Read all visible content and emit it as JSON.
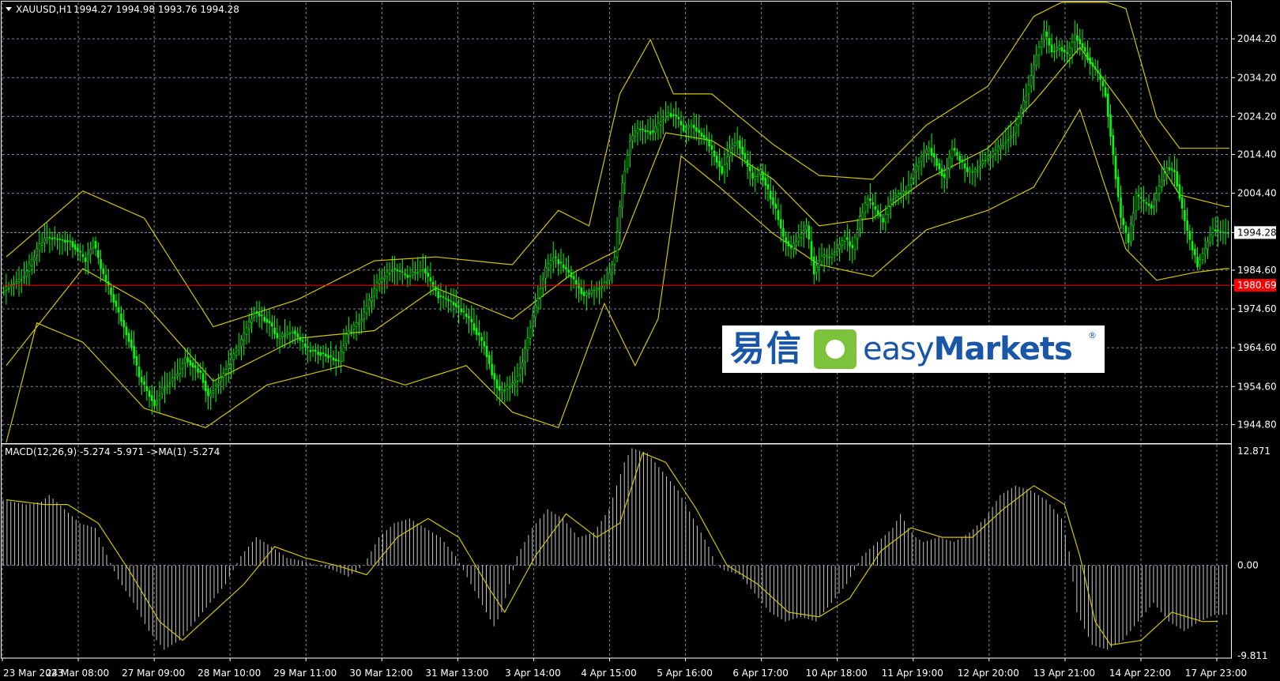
{
  "header": {
    "symbol_label": "XAUUSD,H1",
    "ohlc_label": "1994.27 1994.98 1993.76 1994.28"
  },
  "indicator": {
    "label": "MACD(12,26,9) -5.274 -5.971  ->MA(1) -5.274"
  },
  "logo": {
    "chinese": "易信",
    "english_light": "easy",
    "english_bold": "Markets",
    "registered": "®"
  },
  "colors": {
    "background": "#000000",
    "grid": "#7d8794",
    "candles": "#00ff00",
    "bands": "#d4c400",
    "current_price_line": "#8aa0b4",
    "level_line": "#ff0000",
    "macd_bars": "#c8c8c8",
    "macd_signal": "#d4c400"
  },
  "chart_data": [
    {
      "type": "candlestick",
      "symbol": "XAUUSD",
      "timeframe": "H1",
      "y_ticks": [
        "2044.20",
        "2034.20",
        "2024.20",
        "2014.40",
        "2004.40",
        "1994.28",
        "1984.60",
        "1980.69",
        "1974.60",
        "1964.60",
        "1954.60",
        "1944.80"
      ],
      "ylim": [
        1940.2,
        2053.6
      ],
      "current_price": 1994.28,
      "level_price": 1980.69,
      "x_ticks": [
        "23 Mar 2023",
        "24 Mar 08:00",
        "27 Mar 09:00",
        "28 Mar 10:00",
        "29 Mar 11:00",
        "30 Mar 12:00",
        "31 Mar 13:00",
        "3 Apr 14:00",
        "4 Apr 15:00",
        "5 Apr 16:00",
        "6 Apr 17:00",
        "10 Apr 18:00",
        "11 Apr 19:00",
        "12 Apr 20:00",
        "13 Apr 21:00",
        "14 Apr 22:00",
        "17 Apr 23:00"
      ],
      "close_path": [
        [
          0,
          1979
        ],
        [
          3,
          1983
        ],
        [
          5,
          1991
        ],
        [
          6,
          1993
        ],
        [
          9,
          1992
        ],
        [
          11,
          1987
        ],
        [
          12,
          1992
        ],
        [
          13,
          1985
        ],
        [
          15,
          1975
        ],
        [
          17,
          1965
        ],
        [
          18,
          1957
        ],
        [
          20,
          1950
        ],
        [
          21,
          1954
        ],
        [
          23,
          1958
        ],
        [
          24,
          1962
        ],
        [
          26,
          1958
        ],
        [
          27,
          1952
        ],
        [
          29,
          1958
        ],
        [
          31,
          1965
        ],
        [
          33,
          1974
        ],
        [
          35,
          1971
        ],
        [
          36,
          1967
        ],
        [
          38,
          1969
        ],
        [
          40,
          1964
        ],
        [
          42,
          1963
        ],
        [
          44,
          1961
        ],
        [
          45,
          1968
        ],
        [
          47,
          1972
        ],
        [
          49,
          1981
        ],
        [
          51,
          1985
        ],
        [
          53,
          1983
        ],
        [
          55,
          1985
        ],
        [
          57,
          1978
        ],
        [
          59,
          1976
        ],
        [
          61,
          1972
        ],
        [
          63,
          1965
        ],
        [
          64,
          1958
        ],
        [
          65,
          1953
        ],
        [
          67,
          1956
        ],
        [
          68,
          1961
        ],
        [
          69,
          1970
        ],
        [
          71,
          1985
        ],
        [
          72,
          1988
        ],
        [
          74,
          1984
        ],
        [
          76,
          1978
        ],
        [
          78,
          1980
        ],
        [
          79,
          1982
        ],
        [
          80,
          1988
        ],
        [
          81,
          2007
        ],
        [
          82,
          2018
        ],
        [
          83,
          2021
        ],
        [
          85,
          2020
        ],
        [
          86,
          2023
        ],
        [
          87,
          2025
        ],
        [
          88,
          2024
        ],
        [
          89,
          2021
        ],
        [
          90,
          2022
        ],
        [
          92,
          2018
        ],
        [
          93,
          2014
        ],
        [
          94,
          2010
        ],
        [
          95,
          2016
        ],
        [
          96,
          2018
        ],
        [
          97,
          2013
        ],
        [
          98,
          2008
        ],
        [
          99,
          2010
        ],
        [
          100,
          2005
        ],
        [
          101,
          2000
        ],
        [
          102,
          1993
        ],
        [
          103,
          1990
        ],
        [
          104,
          1993
        ],
        [
          105,
          1996
        ],
        [
          106,
          1984
        ],
        [
          107,
          1988
        ],
        [
          108,
          1988
        ],
        [
          109,
          1990
        ],
        [
          110,
          1993
        ],
        [
          111,
          1990
        ],
        [
          112,
          1998
        ],
        [
          113,
          2003
        ],
        [
          114,
          2000
        ],
        [
          115,
          1997
        ],
        [
          116,
          2003
        ],
        [
          117,
          2004
        ],
        [
          118,
          2005
        ],
        [
          119,
          2010
        ],
        [
          120,
          2014
        ],
        [
          121,
          2016
        ],
        [
          122,
          2012
        ],
        [
          123,
          2008
        ],
        [
          124,
          2016
        ],
        [
          125,
          2013
        ],
        [
          126,
          2010
        ],
        [
          127,
          2010
        ],
        [
          128,
          2013
        ],
        [
          129,
          2014
        ],
        [
          130,
          2016
        ],
        [
          131,
          2018
        ],
        [
          132,
          2020
        ],
        [
          133,
          2026
        ],
        [
          134,
          2032
        ],
        [
          135,
          2040
        ],
        [
          136,
          2046
        ],
        [
          137,
          2041
        ],
        [
          138,
          2042
        ],
        [
          139,
          2040
        ],
        [
          140,
          2045
        ],
        [
          141,
          2042
        ],
        [
          142,
          2038
        ],
        [
          143,
          2035
        ],
        [
          144,
          2030
        ],
        [
          145,
          2014
        ],
        [
          146,
          1998
        ],
        [
          147,
          1992
        ],
        [
          148,
          2004
        ],
        [
          149,
          2002
        ],
        [
          150,
          2001
        ],
        [
          151,
          2006
        ],
        [
          152,
          2011
        ],
        [
          153,
          2010
        ],
        [
          154,
          2000
        ],
        [
          155,
          1992
        ],
        [
          156,
          1986
        ],
        [
          157,
          1990
        ],
        [
          158,
          1995
        ],
        [
          159,
          1994.28
        ]
      ],
      "bands": {
        "middle": [
          [
            0,
            1960
          ],
          [
            10,
            1985
          ],
          [
            18,
            1976
          ],
          [
            27,
            1956
          ],
          [
            38,
            1967
          ],
          [
            48,
            1969
          ],
          [
            56,
            1980
          ],
          [
            66,
            1972
          ],
          [
            74,
            1984
          ],
          [
            80,
            1990
          ],
          [
            86,
            2020
          ],
          [
            92,
            2018
          ],
          [
            100,
            2008
          ],
          [
            106,
            1996
          ],
          [
            113,
            1998
          ],
          [
            120,
            2008
          ],
          [
            128,
            2016
          ],
          [
            134,
            2028
          ],
          [
            140,
            2042
          ],
          [
            146,
            2026
          ],
          [
            153,
            2004
          ],
          [
            159,
            2001
          ]
        ],
        "upper": [
          [
            0,
            1988
          ],
          [
            10,
            2005
          ],
          [
            18,
            1998
          ],
          [
            27,
            1970
          ],
          [
            38,
            1977
          ],
          [
            48,
            1987
          ],
          [
            56,
            1988
          ],
          [
            66,
            1986
          ],
          [
            72,
            2000
          ],
          [
            76,
            1996
          ],
          [
            80,
            2030
          ],
          [
            84,
            2044
          ],
          [
            87,
            2030
          ],
          [
            92,
            2030
          ],
          [
            100,
            2017
          ],
          [
            106,
            2009
          ],
          [
            113,
            2008
          ],
          [
            120,
            2022
          ],
          [
            128,
            2032
          ],
          [
            134,
            2050
          ],
          [
            140,
            2056
          ],
          [
            146,
            2052
          ],
          [
            150,
            2024
          ],
          [
            153,
            2016
          ],
          [
            159,
            2016
          ]
        ],
        "lower": [
          [
            0,
            1940
          ],
          [
            4,
            1971
          ],
          [
            10,
            1966
          ],
          [
            18,
            1949
          ],
          [
            26,
            1944
          ],
          [
            34,
            1955
          ],
          [
            44,
            1960
          ],
          [
            52,
            1955
          ],
          [
            60,
            1960
          ],
          [
            66,
            1948
          ],
          [
            72,
            1944
          ],
          [
            78,
            1976
          ],
          [
            82,
            1960
          ],
          [
            85,
            1972
          ],
          [
            88,
            2014
          ],
          [
            93,
            2006
          ],
          [
            100,
            1994
          ],
          [
            106,
            1986
          ],
          [
            113,
            1983
          ],
          [
            120,
            1995
          ],
          [
            128,
            2000
          ],
          [
            134,
            2006
          ],
          [
            140,
            2026
          ],
          [
            146,
            1990
          ],
          [
            150,
            1982
          ],
          [
            155,
            1984
          ],
          [
            159,
            1985
          ]
        ]
      }
    },
    {
      "type": "bar",
      "name": "MACD(12,26,9)",
      "y_ticks": [
        "12.871",
        "0.00",
        "-9.811"
      ],
      "ylim": [
        -9.811,
        12.871
      ],
      "macd_path": [
        [
          0,
          7
        ],
        [
          3,
          6.5
        ],
        [
          5,
          6.8
        ],
        [
          6,
          7.5
        ],
        [
          8,
          6
        ],
        [
          10,
          4.5
        ],
        [
          12,
          4
        ],
        [
          13,
          2
        ],
        [
          15,
          -1.5
        ],
        [
          17,
          -4
        ],
        [
          19,
          -7
        ],
        [
          21,
          -9
        ],
        [
          23,
          -8
        ],
        [
          25,
          -6
        ],
        [
          27,
          -4
        ],
        [
          29,
          -2
        ],
        [
          31,
          1
        ],
        [
          33,
          3
        ],
        [
          35,
          2
        ],
        [
          37,
          0.8
        ],
        [
          39,
          0.5
        ],
        [
          41,
          0
        ],
        [
          43,
          -0.5
        ],
        [
          45,
          -1.2
        ],
        [
          47,
          0
        ],
        [
          49,
          3
        ],
        [
          51,
          4.5
        ],
        [
          53,
          5
        ],
        [
          55,
          4
        ],
        [
          57,
          3
        ],
        [
          59,
          1
        ],
        [
          61,
          -2
        ],
        [
          63,
          -5
        ],
        [
          64,
          -6.5
        ],
        [
          65,
          -5
        ],
        [
          67,
          1
        ],
        [
          69,
          4
        ],
        [
          71,
          6
        ],
        [
          73,
          5
        ],
        [
          75,
          3
        ],
        [
          77,
          3.5
        ],
        [
          79,
          6
        ],
        [
          81,
          11
        ],
        [
          82,
          12.5
        ],
        [
          84,
          12
        ],
        [
          86,
          10
        ],
        [
          88,
          8
        ],
        [
          90,
          5
        ],
        [
          92,
          2
        ],
        [
          93,
          0
        ],
        [
          94,
          -0.5
        ],
        [
          96,
          -1
        ],
        [
          98,
          -3
        ],
        [
          100,
          -5
        ],
        [
          102,
          -6
        ],
        [
          104,
          -5.5
        ],
        [
          106,
          -6
        ],
        [
          108,
          -4
        ],
        [
          110,
          -2
        ],
        [
          112,
          1
        ],
        [
          114,
          2.5
        ],
        [
          116,
          4
        ],
        [
          117,
          5.5
        ],
        [
          118,
          4
        ],
        [
          119,
          3
        ],
        [
          120,
          2.5
        ],
        [
          122,
          3
        ],
        [
          124,
          2.5
        ],
        [
          126,
          3.5
        ],
        [
          128,
          5
        ],
        [
          130,
          7.5
        ],
        [
          132,
          8.5
        ],
        [
          134,
          8
        ],
        [
          136,
          7
        ],
        [
          138,
          5
        ],
        [
          139,
          1.5
        ],
        [
          140,
          -5
        ],
        [
          142,
          -8.5
        ],
        [
          144,
          -9
        ],
        [
          146,
          -8
        ],
        [
          148,
          -6
        ],
        [
          150,
          -4
        ],
        [
          152,
          -6
        ],
        [
          154,
          -7
        ],
        [
          156,
          -6
        ],
        [
          158,
          -5.274
        ]
      ],
      "signal_path": [
        [
          0,
          7
        ],
        [
          5,
          6.5
        ],
        [
          8,
          6.5
        ],
        [
          12,
          4.5
        ],
        [
          16,
          -0.5
        ],
        [
          20,
          -6
        ],
        [
          23,
          -8
        ],
        [
          27,
          -5
        ],
        [
          31,
          -2
        ],
        [
          35,
          2
        ],
        [
          39,
          0.8
        ],
        [
          43,
          0
        ],
        [
          47,
          -1
        ],
        [
          51,
          3
        ],
        [
          55,
          5
        ],
        [
          59,
          3
        ],
        [
          63,
          -2.5
        ],
        [
          65,
          -5
        ],
        [
          69,
          1
        ],
        [
          73,
          5.5
        ],
        [
          77,
          3
        ],
        [
          80,
          4.5
        ],
        [
          83,
          12
        ],
        [
          86,
          11
        ],
        [
          90,
          6
        ],
        [
          94,
          0
        ],
        [
          98,
          -2
        ],
        [
          102,
          -5
        ],
        [
          106,
          -5.5
        ],
        [
          110,
          -3.5
        ],
        [
          114,
          1.5
        ],
        [
          118,
          4
        ],
        [
          122,
          3
        ],
        [
          126,
          3
        ],
        [
          130,
          6
        ],
        [
          134,
          8.5
        ],
        [
          138,
          6.5
        ],
        [
          140,
          1
        ],
        [
          142,
          -6
        ],
        [
          144,
          -8.5
        ],
        [
          148,
          -8
        ],
        [
          152,
          -5
        ],
        [
          156,
          -6
        ],
        [
          158,
          -5.971
        ]
      ]
    }
  ]
}
